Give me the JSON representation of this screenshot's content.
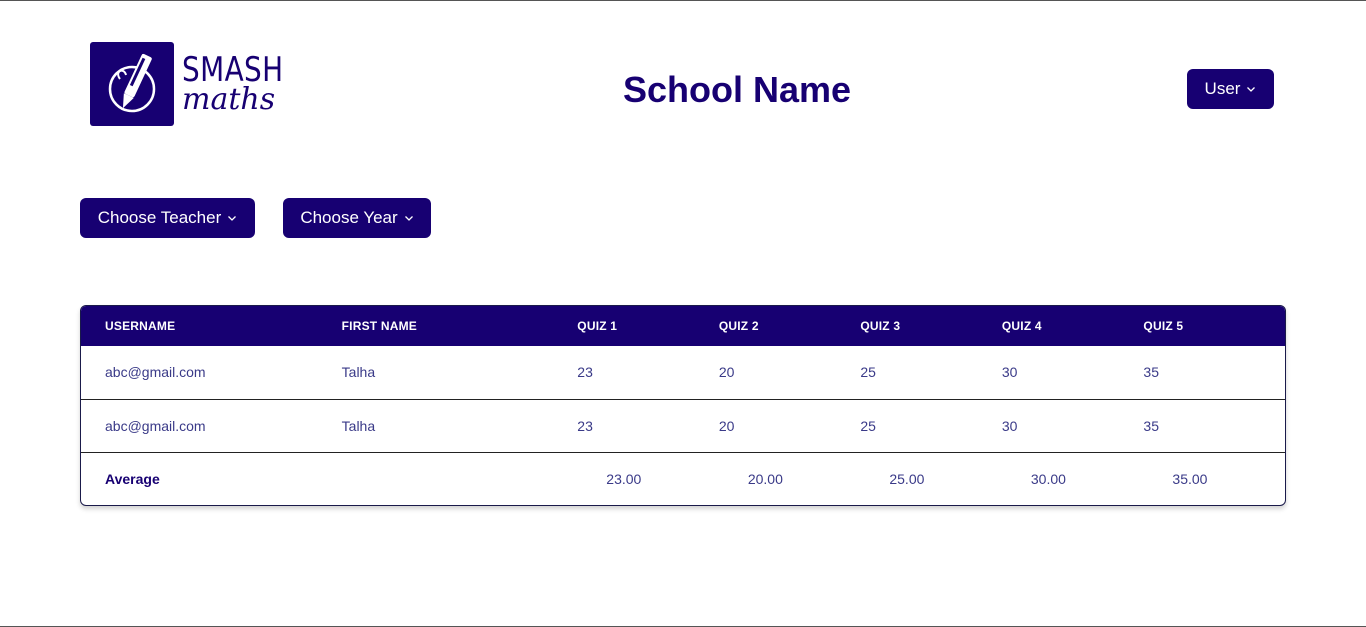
{
  "logo": {
    "word1": "SMASH",
    "word2": "maths"
  },
  "header": {
    "title": "School Name",
    "user_label": "User"
  },
  "filters": {
    "teacher_label": "Choose Teacher",
    "year_label": "Choose Year"
  },
  "table": {
    "columns": [
      "USERNAME",
      "FIRST NAME",
      "QUIZ 1",
      "QUIZ 2",
      "QUIZ 3",
      "QUIZ 4",
      "QUIZ 5"
    ],
    "rows": [
      [
        "abc@gmail.com",
        "Talha",
        "23",
        "20",
        "25",
        "30",
        "35"
      ],
      [
        "abc@gmail.com",
        "Talha",
        "23",
        "20",
        "25",
        "30",
        "35"
      ]
    ],
    "average": {
      "label": "Average",
      "values": [
        "23.00",
        "20.00",
        "25.00",
        "30.00",
        "35.00"
      ]
    }
  },
  "colors": {
    "brand": "#170072",
    "text": "#3a3a88"
  },
  "icons": [
    "pen-logo-icon",
    "chevron-down-icon"
  ]
}
